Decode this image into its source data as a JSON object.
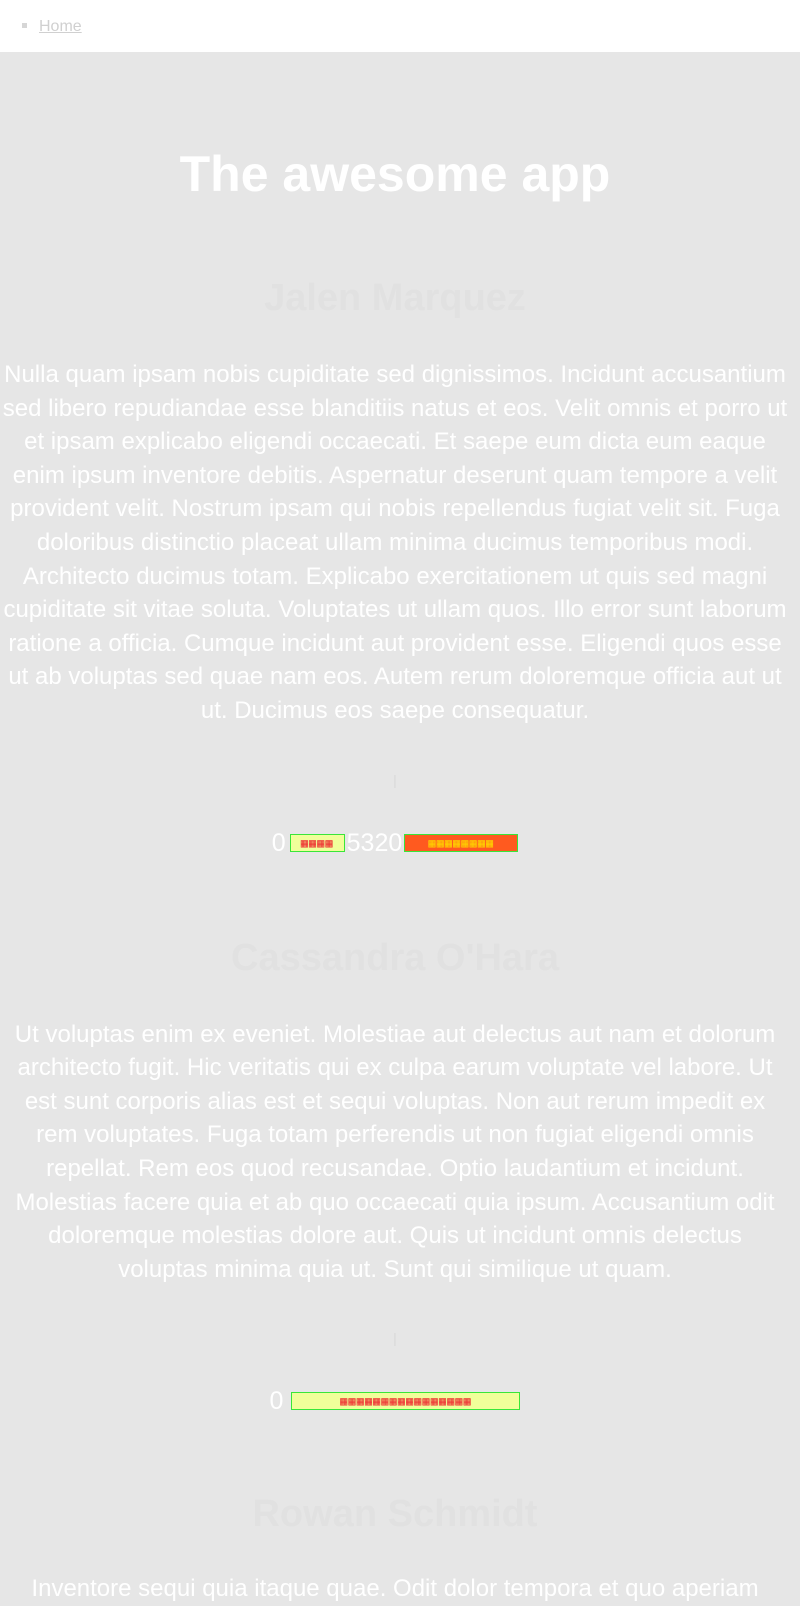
{
  "nav": {
    "home_label": "Home"
  },
  "header": {
    "title": "The awesome app"
  },
  "sections": [
    {
      "name": "Jalen Marquez",
      "body": "Nulla quam ipsam nobis cupiditate sed dignissimos. Incidunt accusantium sed libero repudiandae esse blanditiis natus et eos. Velit omnis et porro ut et ipsam explicabo eligendi occaecati. Et saepe eum dicta eum eaque enim ipsum inventore debitis. Aspernatur deserunt quam tempore a velit provident velit. Nostrum ipsam qui nobis repellendus fugiat velit sit. Fuga doloribus distinctio placeat ullam minima ducimus temporibus modi. Architecto ducimus totam. Explicabo exercitationem ut quis sed magni cupiditate sit vitae soluta. Voluptates ut ullam quos. Illo error sunt laborum ratione a officia. Cumque incidunt aut provident esse. Eligendi quos esse ut ab voluptas sed quae nam eos. Autem rerum doloremque officia aut ut ut. Ducimus eos saepe consequatur.",
      "divider": "|",
      "phone_prefix": "0",
      "phone_mid": "5320"
    },
    {
      "name": "Cassandra O'Hara",
      "body": "Ut voluptas enim ex eveniet. Molestiae aut delectus aut nam et dolorum architecto fugit. Hic veritatis qui ex culpa earum voluptate vel labore. Ut est sunt corporis alias est et sequi voluptas. Non aut rerum impedit ex rem voluptates. Fuga totam perferendis ut non fugiat eligendi omnis repellat. Rem eos quod recusandae. Optio laudantium et incidunt. Molestias facere quia et ab quo occaecati quia ipsum. Accusantium odit doloremque molestias dolore aut. Quis ut incidunt omnis delectus voluptas minima quia ut. Sunt qui similique ut quam.",
      "divider": "|",
      "phone_prefix": "0"
    },
    {
      "name": "Rowan Schmidt",
      "body": "Inventore sequi quia itaque quae. Odit dolor tempora et quo aperiam"
    }
  ]
}
